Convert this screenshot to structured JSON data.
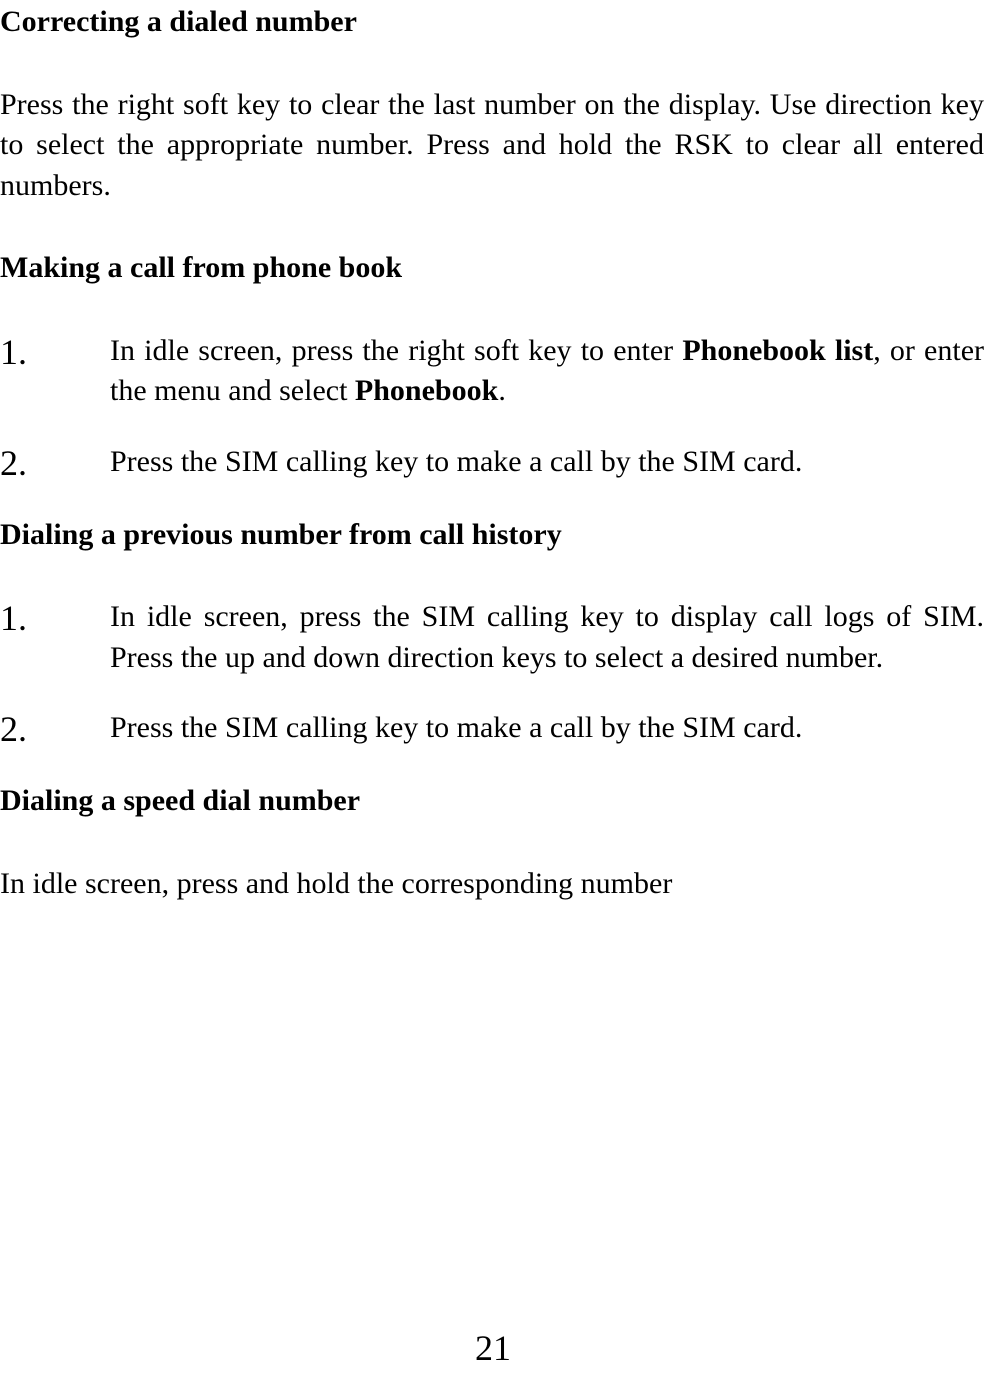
{
  "sections": {
    "correcting": {
      "heading": "Correcting a dialed number",
      "paragraph": "Press the right soft key to clear the last number on the display. Use direction key to select the appropriate number. Press and hold the RSK to clear all entered numbers."
    },
    "phonebook": {
      "heading": "Making a call from phone book",
      "items": [
        {
          "number": "1.",
          "text_parts": [
            "In idle screen, press the right soft key to enter ",
            "Phonebook list",
            ", or enter the menu and select ",
            "Phonebook",
            "."
          ]
        },
        {
          "number": "2.",
          "text_parts": [
            "Press the SIM calling key to make a call by the SIM card."
          ]
        }
      ]
    },
    "history": {
      "heading": "Dialing a previous number from call history",
      "items": [
        {
          "number": "1.",
          "text_parts": [
            "In idle screen, press the SIM calling key to display call logs of SIM. Press the up and down direction keys to select a desired number."
          ]
        },
        {
          "number": "2.",
          "text_parts": [
            "Press the SIM calling key to make a call by the SIM card."
          ]
        }
      ]
    },
    "speed": {
      "heading": "Dialing a speed dial number",
      "paragraph": "In idle screen, press and hold the corresponding number"
    }
  },
  "page_number": "21"
}
